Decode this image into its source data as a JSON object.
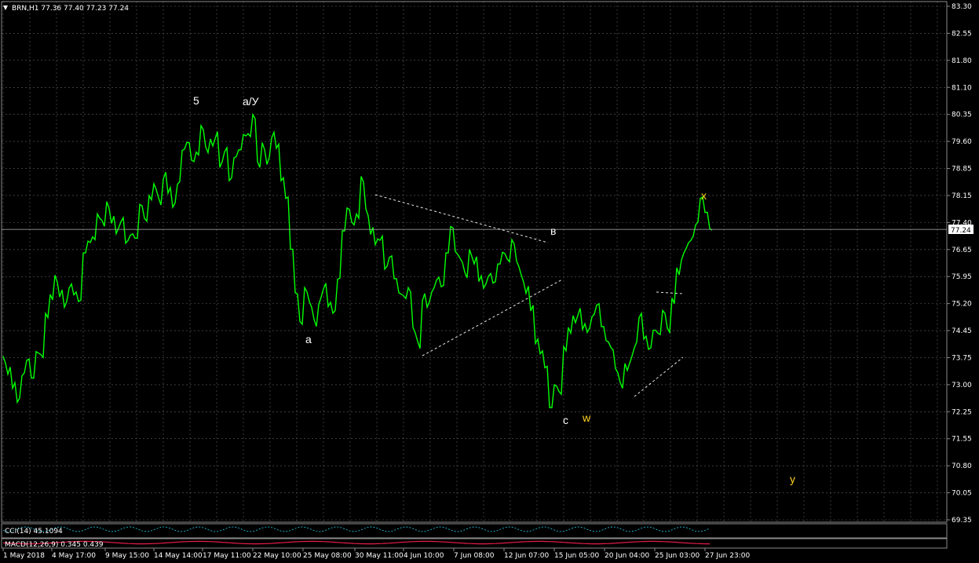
{
  "window": {
    "header": "BRN,H1  77.36 77.40 77.23 77.24"
  },
  "colors": {
    "background": "#000000",
    "grid": "#5f5f5f",
    "price_line": "#00ff00",
    "axis_text": "#ffffff",
    "wave_white": "#ffffff",
    "wave_yellow": "#ffd21f",
    "trendline": "#ffffff",
    "price_label_bg": "#ffffff",
    "price_label_text": "#000000",
    "indicator_cyan": "#22d3ee",
    "indicator_red": "#e11d48"
  },
  "icons": {
    "menu": "menu-triangle-icon"
  },
  "price_axis": {
    "ticks": [
      "83.30",
      "82.55",
      "81.80",
      "81.10",
      "80.35",
      "79.60",
      "78.85",
      "78.15",
      "77.40",
      "76.65",
      "75.95",
      "75.20",
      "74.45",
      "73.75",
      "73.00",
      "72.25",
      "71.55",
      "70.80",
      "70.05",
      "69.35"
    ],
    "current": "77.24"
  },
  "time_axis": {
    "ticks": [
      "1 May 2018",
      "4 May 17:00",
      "9 May 15:00",
      "14 May 14:00",
      "17 May 11:00",
      "22 May 10:00",
      "25 May 08:00",
      "30 May 11:00",
      "4 Jun 10:00",
      "7 Jun 08:00",
      "12 Jun 07:00",
      "15 Jun 05:00",
      "20 Jun 04:00",
      "25 Jun 03:00",
      "27 Jun 23:00"
    ]
  },
  "waves": [
    {
      "label": "5",
      "style": "white"
    },
    {
      "label": "а/У",
      "style": "white"
    },
    {
      "label": "а",
      "style": "white"
    },
    {
      "label": "в",
      "style": "white"
    },
    {
      "label": "с",
      "style": "white"
    },
    {
      "label": "w",
      "style": "yellow"
    },
    {
      "label": "x",
      "style": "yellow"
    },
    {
      "label": "y",
      "style": "yellow"
    }
  ],
  "indicators": {
    "cci": {
      "label": "CCI(14) 45.1094"
    },
    "macd": {
      "label": "MACD(12,26,9) 0.345 0.439"
    }
  },
  "chart_data": {
    "type": "line",
    "symbol": "BRN",
    "timeframe": "H1",
    "series": [
      {
        "name": "BRN",
        "values": [
          73.7,
          73.4,
          73.0,
          72.6,
          73.3,
          73.7,
          73.2,
          73.9,
          73.8,
          74.9,
          75.4,
          75.9,
          75.5,
          75.2,
          75.7,
          75.5,
          75.3,
          76.6,
          76.9,
          77.0,
          77.6,
          77.4,
          77.9,
          77.5,
          77.2,
          77.5,
          76.9,
          77.1,
          77.0,
          77.9,
          77.5,
          78.1,
          78.4,
          78.0,
          78.7,
          78.3,
          77.9,
          78.5,
          79.4,
          79.6,
          79.1,
          79.3,
          80.0,
          79.4,
          79.6,
          79.8,
          79.0,
          79.4,
          78.6,
          79.2,
          79.4,
          79.8,
          79.8,
          80.3,
          79.0,
          79.5,
          79.1,
          79.8,
          79.5,
          78.6,
          78.1,
          76.7,
          75.5,
          74.7,
          75.6,
          75.2,
          74.7,
          75.3,
          75.7,
          75.2,
          75.0,
          75.9,
          77.2,
          77.8,
          77.4,
          77.6,
          78.6,
          77.7,
          77.2,
          76.9,
          77.0,
          76.2,
          76.5,
          75.9,
          75.5,
          75.4,
          75.6,
          74.5,
          74.1,
          75.4,
          75.2,
          75.6,
          75.9,
          75.7,
          76.6,
          77.3,
          76.6,
          76.4,
          76.0,
          76.6,
          76.4,
          75.9,
          75.7,
          76.0,
          75.8,
          76.3,
          76.6,
          76.4,
          76.9,
          76.3,
          75.9,
          75.6,
          75.1,
          74.2,
          73.9,
          73.5,
          72.4,
          73.0,
          72.8,
          74.0,
          74.5,
          74.8,
          75.0,
          74.6,
          74.5,
          74.9,
          75.2,
          74.6,
          74.2,
          74.0,
          73.4,
          73.0,
          73.5,
          73.7,
          74.1,
          74.9,
          74.3,
          74.0,
          74.5,
          74.4,
          75.0,
          74.5,
          75.3,
          76.1,
          76.5,
          76.8,
          77.0,
          77.4,
          78.1,
          77.7,
          77.24
        ],
        "markers": [
          "5",
          "а/У",
          "а",
          "в",
          "с",
          "w",
          "x",
          "y"
        ]
      }
    ],
    "ylim": [
      69.35,
      83.3
    ],
    "grid": true,
    "legend": "none"
  }
}
